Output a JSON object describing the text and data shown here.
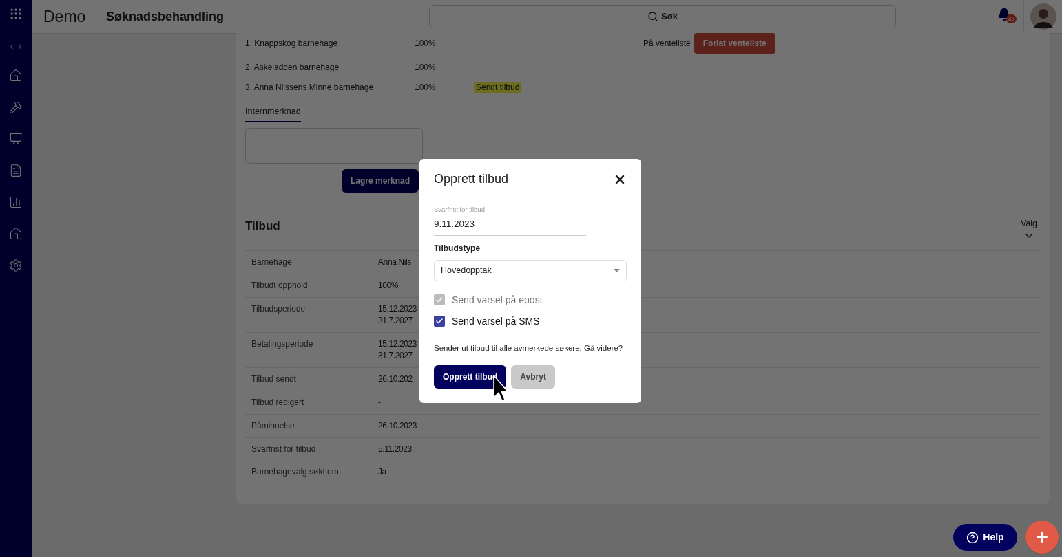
{
  "header": {
    "app_name": "Demo",
    "page_title": "Søknadsbehandling",
    "search": {
      "placeholder": "Søk"
    },
    "notifications": {
      "count": "33"
    }
  },
  "wishes": [
    {
      "name": "1. Knappskog barnehage",
      "share": "100%",
      "status": "På venteliste",
      "action": "Forlat venteliste"
    },
    {
      "name": "2. Askeladden barnehage",
      "share": "100%"
    },
    {
      "name": "3. Anna Nilssens Minne barnehage",
      "share": "100%",
      "badge": "Sendt tilbud"
    }
  ],
  "note": {
    "tab": {
      "label": "Internmerknad",
      "selected": true
    },
    "save_button": "Lagre merknad"
  },
  "offer": {
    "title": "Tilbud",
    "menu": "Valg",
    "rows": [
      {
        "label": "Barnehage",
        "values": [
          "Anna Nils"
        ]
      },
      {
        "label": "Tilbudt opphold",
        "values": [
          "100%"
        ]
      },
      {
        "label": "Tilbudsperiode",
        "values": [
          "15.12.2023",
          "31.7.2027"
        ]
      },
      {
        "label": "Betalingsperiode",
        "values": [
          "15.12.2023",
          "31.7.2027"
        ]
      },
      {
        "label": "Tilbud sendt",
        "values": [
          "26.10.202"
        ]
      },
      {
        "label": "Tilbud redigert",
        "values": [
          "-"
        ]
      },
      {
        "label": "Påminnelse",
        "values": [
          "26.10.2023"
        ]
      },
      {
        "label": "Svarfrist for tilbud",
        "values": [
          "5.11.2023"
        ]
      },
      {
        "label": "Barnehagevalg søkt om",
        "values": [
          "Ja"
        ]
      }
    ]
  },
  "dialog": {
    "title": "Opprett tilbud",
    "date_field": {
      "label": "Svarfrist for tilbud",
      "value": "9.11.2023"
    },
    "type_label": "Tilbudstype",
    "type_value": "Hovedopptak",
    "options": [
      {
        "label": "Send varsel på epost",
        "checked": true,
        "disabled": true
      },
      {
        "label": "Send varsel på SMS",
        "checked": true,
        "disabled": false
      }
    ],
    "message": "Sender ut tilbud til alle avmerkede søkere. Gå videre?",
    "confirm": "Opprett tilbud",
    "cancel": "Avbryt"
  },
  "help_button": "Help"
}
